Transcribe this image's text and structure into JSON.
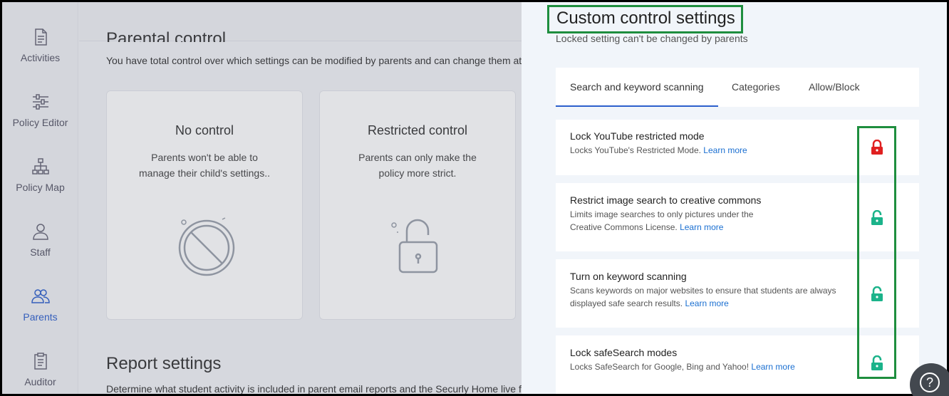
{
  "sidebar": {
    "items": [
      {
        "label": "Activities",
        "icon": "document-icon"
      },
      {
        "label": "Policy Editor",
        "icon": "sliders-icon"
      },
      {
        "label": "Policy Map",
        "icon": "sitemap-icon"
      },
      {
        "label": "Staff",
        "icon": "user-icon"
      },
      {
        "label": "Parents",
        "icon": "users-icon"
      },
      {
        "label": "Auditor",
        "icon": "clipboard-icon"
      }
    ],
    "active": "Parents"
  },
  "parental_control": {
    "title": "Parental control",
    "description": "You have total control over which settings can be modified by parents and can change them at",
    "cards": [
      {
        "title": "No control",
        "text_line1": "Parents won't be able to",
        "text_line2": "manage their child's settings..",
        "icon": "prohibited-icon"
      },
      {
        "title": "Restricted control",
        "text_line1": "Parents can only make the",
        "text_line2": "policy more strict.",
        "icon": "padlock-icon"
      }
    ]
  },
  "report_settings": {
    "title": "Report settings",
    "description": "Determine what student activity is included in parent email reports and the Securly Home live fe"
  },
  "panel": {
    "title": "Custom control settings",
    "subtitle": "Locked setting can't be changed by parents",
    "tabs": [
      "Search and keyword scanning",
      "Categories",
      "Allow/Block"
    ],
    "active_tab": "Search and keyword scanning",
    "settings": [
      {
        "title": "Lock YouTube restricted mode",
        "desc": "Locks YouTube's Restricted Mode.",
        "link": "Learn more",
        "locked": true
      },
      {
        "title": "Restrict image search to creative commons",
        "desc": "Limits image searches to only pictures under the Creative Commons License.",
        "link": "Learn more",
        "locked": false
      },
      {
        "title": "Turn on keyword scanning",
        "desc": "Scans keywords on major websites to ensure that students are always displayed safe search results.",
        "link": "Learn more",
        "locked": false
      },
      {
        "title": "Lock safeSearch modes",
        "desc": "Locks SafeSearch for Google, Bing and Yahoo!",
        "link": "Learn more",
        "locked": false
      }
    ]
  },
  "help": {
    "symbol": "?"
  },
  "colors": {
    "accent": "#2c5fcc",
    "locked": "#e02020",
    "unlocked": "#1bb38a",
    "highlight": "#1e8e3e",
    "link": "#1a6fd1"
  }
}
